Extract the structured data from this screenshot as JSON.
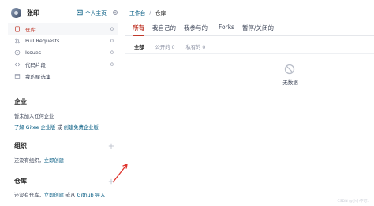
{
  "user": {
    "name": "张印",
    "home_link": "个人主页"
  },
  "menu": [
    {
      "label": "仓库",
      "count": "0",
      "icon": "repo-icon"
    },
    {
      "label": "Pull Requests",
      "count": "0",
      "icon": "pull-request-icon"
    },
    {
      "label": "Issues",
      "count": "0",
      "icon": "issues-icon"
    },
    {
      "label": "代码片段",
      "count": "0",
      "icon": "code-snippet-icon"
    },
    {
      "label": "我的星选集",
      "count": "",
      "icon": "star-collection-icon"
    }
  ],
  "enterprise": {
    "title": "企业",
    "empty_text": "暂未加入任何企业",
    "link_learn": "了解 Gitee 企业版",
    "link_or": "或",
    "link_create": "创建免费企业版"
  },
  "organization": {
    "title": "组织",
    "empty_text": "还没有组织，",
    "create_link": "立即创建"
  },
  "repository": {
    "title": "仓库",
    "empty_text": "还没有仓库，",
    "create_link": "立即创建",
    "or_text": " 或从 ",
    "import_link": "Github 导入"
  },
  "breadcrumb": {
    "workbench": "工作台",
    "separator": "/",
    "current": "仓库"
  },
  "tabs": [
    "所有",
    "我自己的",
    "我参与的",
    "Forks",
    "暂停/关闭的"
  ],
  "subtabs": [
    "全部",
    "公开的",
    "私有的"
  ],
  "subtab_counts": [
    "0",
    "0",
    "0"
  ],
  "empty_state": {
    "text": "无数据"
  },
  "watermark": "CSDN @小小不可1",
  "colors": {
    "accent": "#c0392b",
    "link": "#005980",
    "text": "#40485b"
  }
}
